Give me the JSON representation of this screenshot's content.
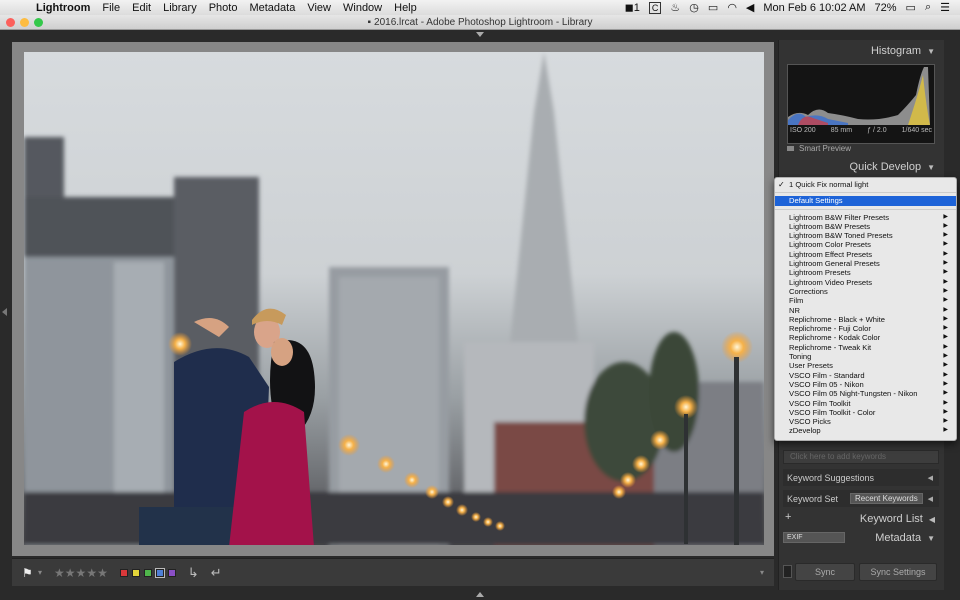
{
  "menubar": {
    "app_name": "Lightroom",
    "items": [
      "File",
      "Edit",
      "Library",
      "Photo",
      "Metadata",
      "View",
      "Window",
      "Help"
    ],
    "status_icons": [
      "1",
      "C"
    ],
    "datetime": "Mon Feb 6  10:02 AM",
    "battery": "72%"
  },
  "window": {
    "title": "2016.lrcat - Adobe Photoshop Lightroom - Library"
  },
  "right_panel": {
    "histogram_label": "Histogram",
    "histogram_info": {
      "iso": "ISO 200",
      "focal": "85 mm",
      "aperture": "ƒ / 2.0",
      "shutter": "1/640 sec"
    },
    "smart_preview": "Smart Preview",
    "quick_develop_label": "Quick Develop",
    "keyword_input_placeholder": "Click here to add keywords",
    "keyword_suggestions_label": "Keyword Suggestions",
    "keyword_set_label": "Keyword Set",
    "keyword_set_value": "Recent Keywords",
    "keyword_list_label": "Keyword List",
    "exif_value": "EXIF",
    "metadata_label": "Metadata",
    "sync_label": "Sync",
    "sync_settings_label": "Sync Settings"
  },
  "preset_menu": {
    "checked": "1 Quick Fix normal light",
    "highlighted": "Default Settings",
    "items": [
      "Lightroom B&W Filter Presets",
      "Lightroom B&W Presets",
      "Lightroom B&W Toned Presets",
      "Lightroom Color Presets",
      "Lightroom Effect Presets",
      "Lightroom General Presets",
      "Lightroom Presets",
      "Lightroom Video Presets",
      "Corrections",
      "Film",
      "NR",
      "Replichrome - Black + White",
      "Replichrome - Fuji Color",
      "Replichrome - Kodak Color",
      "Replichrome - Tweak Kit",
      "Toning",
      "User Presets",
      "VSCO Film - Standard",
      "VSCO Film 05 - Nikon",
      "VSCO Film 05 Night-Tungsten - Nikon",
      "VSCO Film Toolkit",
      "VSCO Film Toolkit - Color",
      "VSCO Picks",
      "zDevelop"
    ]
  },
  "toolbar": {
    "color_labels": [
      "#d9383a",
      "#e3d53a",
      "#4fb64b",
      "#4f7fd6",
      "#8a4fc6"
    ]
  },
  "icons": {
    "apple": "apple-icon",
    "flag": "flag-icon",
    "star": "star-icon",
    "rotate_left": "rotate-left-icon",
    "rotate_right": "rotate-right-icon",
    "submenu_arrow": "triangle-right-icon"
  }
}
